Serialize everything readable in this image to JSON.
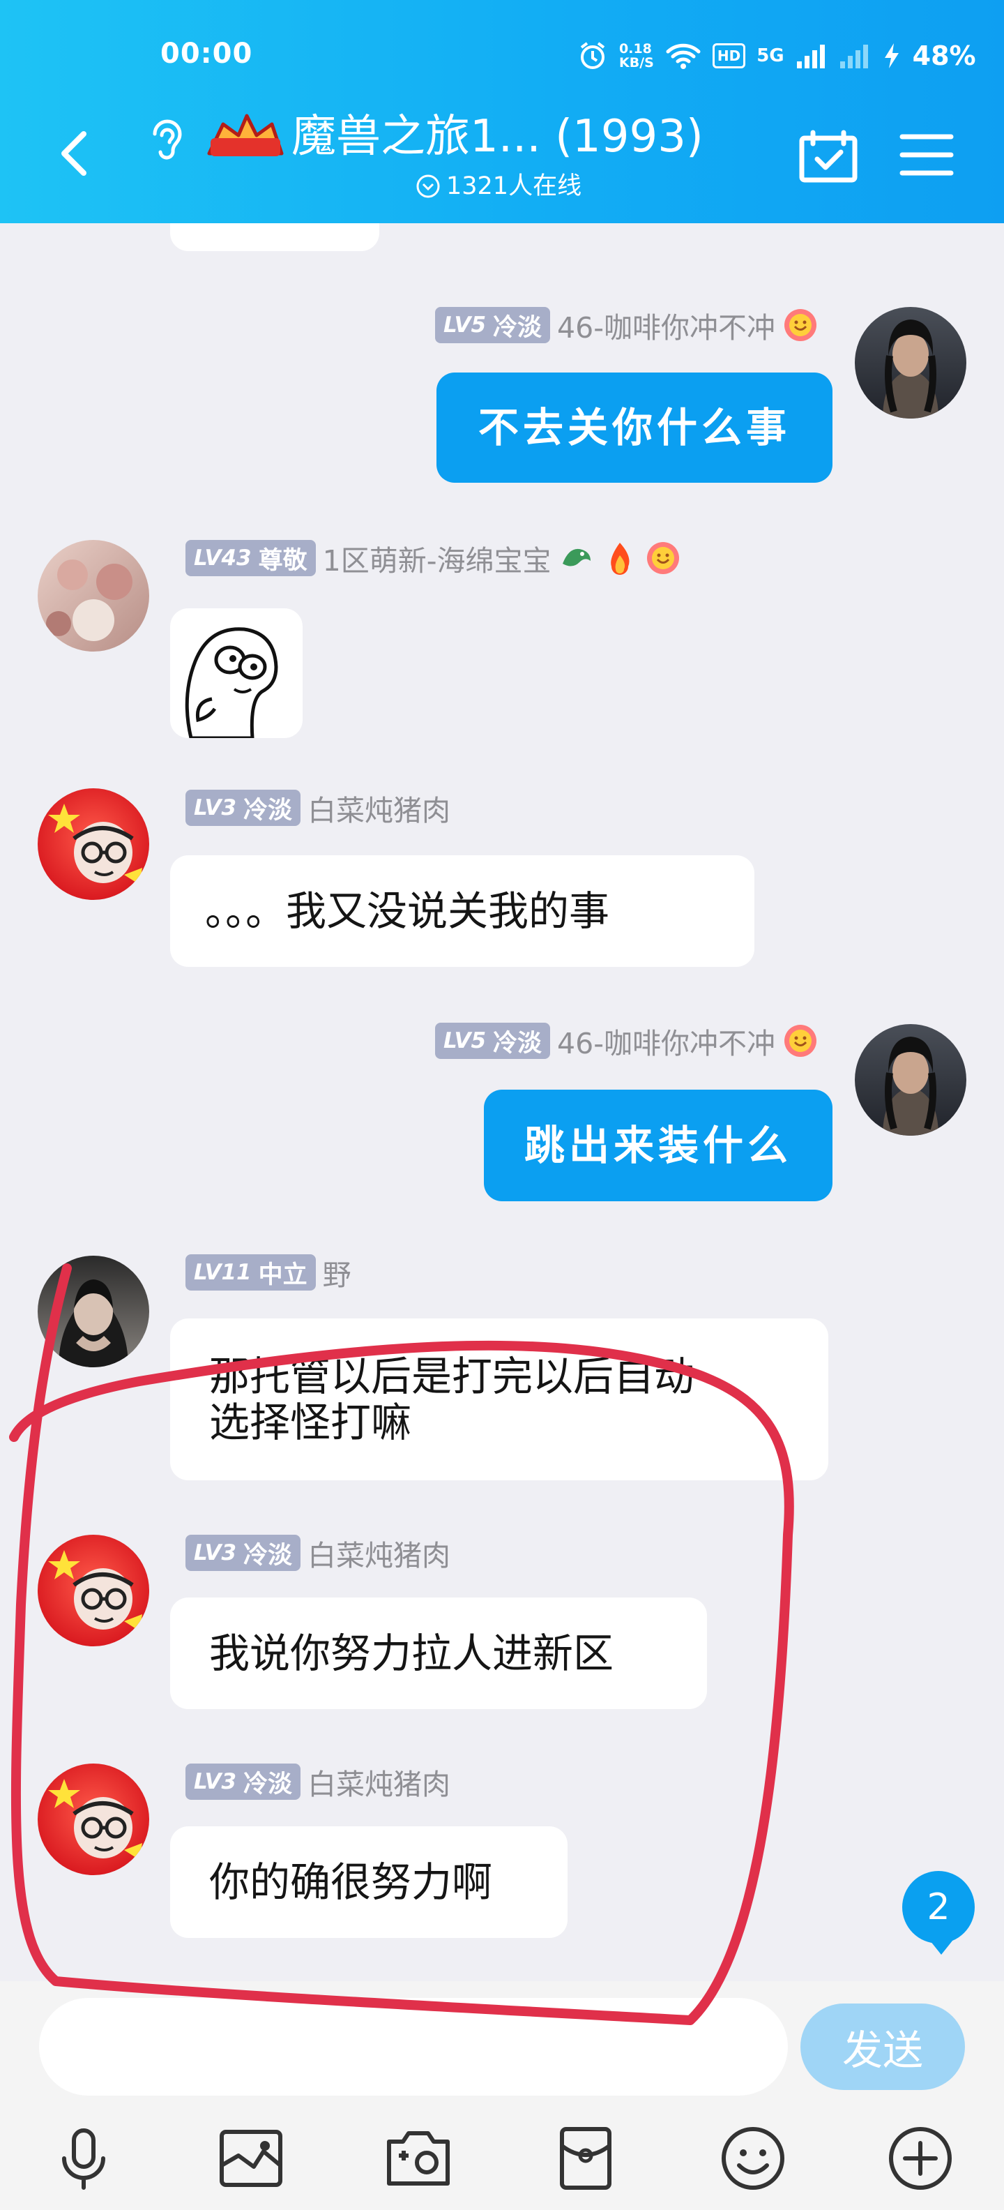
{
  "status_bar": {
    "time": "00:00",
    "net_speed_value": "0.18",
    "net_speed_unit": "KB/S",
    "hd_label": "HD",
    "network": "5G",
    "battery": "48%"
  },
  "header": {
    "title": "魔兽之旅1... (1993)",
    "online": "1321人在线"
  },
  "messages": [
    {
      "side": "right",
      "level": "LV5",
      "rank": "冷淡",
      "nickname": "46-咖啡你冲不冲",
      "text": "不去关你什么事",
      "avatar": "dark-hair-warrior-avatar"
    },
    {
      "side": "left",
      "level": "LV43",
      "rank": "尊敬",
      "nickname": "1区萌新-海绵宝宝",
      "content_type": "sticker",
      "avatar": "pink-flowers-avatar"
    },
    {
      "side": "left",
      "level": "LV3",
      "rank": "冷淡",
      "nickname": "白菜炖猪肉",
      "text": "。。。我又没说关我的事",
      "avatar": "china-flag-cartoon-avatar"
    },
    {
      "side": "right",
      "level": "LV5",
      "rank": "冷淡",
      "nickname": "46-咖啡你冲不冲",
      "text": "跳出来装什么",
      "avatar": "dark-hair-warrior-avatar"
    },
    {
      "side": "left",
      "level": "LV11",
      "rank": "中立",
      "nickname": "野",
      "text_lines": [
        "那托管以后是打完以后自动",
        "选择怪打嘛"
      ],
      "avatar": "woman-portrait-avatar"
    },
    {
      "side": "left",
      "level": "LV3",
      "rank": "冷淡",
      "nickname": "白菜炖猪肉",
      "text": "我说你努力拉人进新区",
      "avatar": "china-flag-cartoon-avatar"
    },
    {
      "side": "left",
      "level": "LV3",
      "rank": "冷淡",
      "nickname": "白菜炖猪肉",
      "text": "你的确很努力啊",
      "avatar": "china-flag-cartoon-avatar"
    }
  ],
  "unread_badge": "2",
  "input": {
    "placeholder": "",
    "send_label": "发送"
  },
  "toolbar": [
    "mic-icon",
    "image-icon",
    "camera-icon",
    "red-packet-icon",
    "emoji-icon",
    "plus-icon"
  ],
  "colors": {
    "header": "#12adf4",
    "bubble_self": "#0b9ff1",
    "send_button": "#9fd5f6",
    "annotation": "#e0304a"
  }
}
